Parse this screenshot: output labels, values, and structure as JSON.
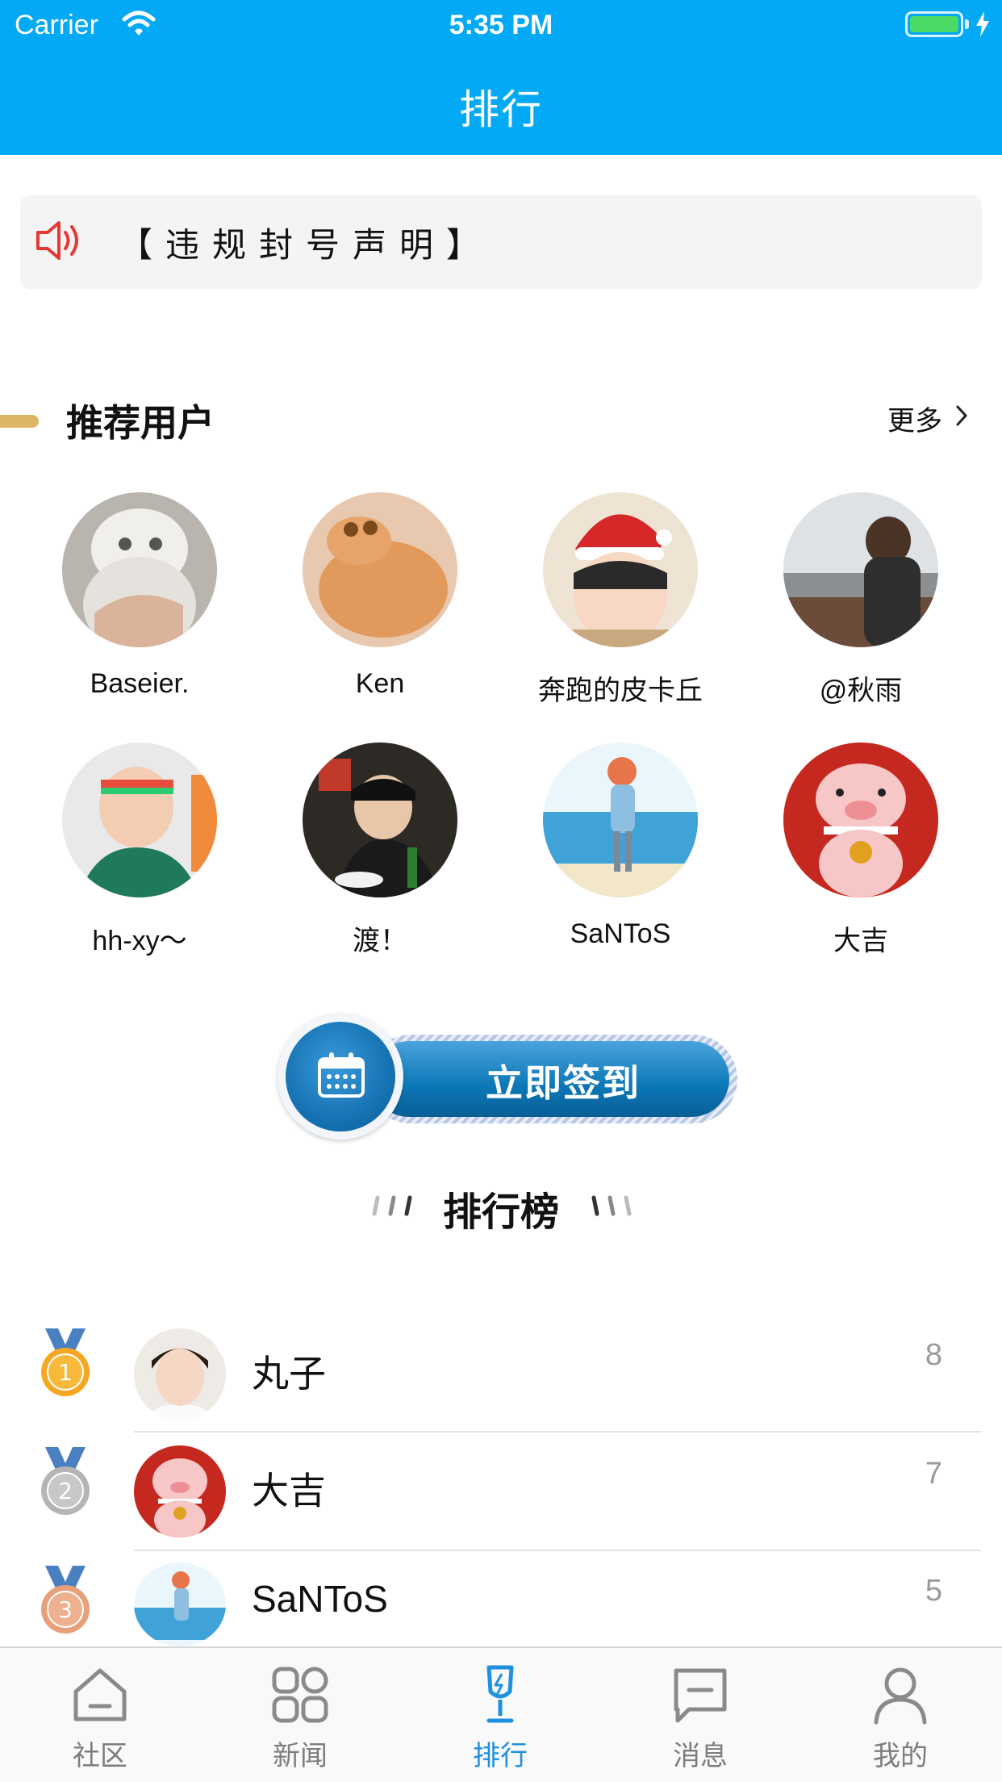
{
  "status_bar": {
    "carrier": "Carrier",
    "time": "5:35 PM"
  },
  "nav": {
    "title": "排行"
  },
  "notice": {
    "text": "【违规封号声明】",
    "icon": "speaker-icon"
  },
  "recommended": {
    "title": "推荐用户",
    "more_label": "更多",
    "users": [
      {
        "name": "Baseier."
      },
      {
        "name": "Ken"
      },
      {
        "name": "奔跑的皮卡丘"
      },
      {
        "name": "@秋雨"
      },
      {
        "name": "hh-xy～"
      },
      {
        "name": "渡！"
      },
      {
        "name": "SaNToS"
      },
      {
        "name": "大吉"
      }
    ]
  },
  "checkin": {
    "label": "立即签到",
    "icon": "calendar-icon"
  },
  "ranking": {
    "title": "排行榜",
    "rows": [
      {
        "rank": "1",
        "name": "丸子",
        "score": "8",
        "medal_color": "#f5a623"
      },
      {
        "rank": "2",
        "name": "大吉",
        "score": "7",
        "medal_color": "#b5b5b5"
      },
      {
        "rank": "3",
        "name": "SaNToS",
        "score": "5",
        "medal_color": "#e8a07a"
      }
    ]
  },
  "tabbar": {
    "active_color": "#1e90e0",
    "tabs": [
      {
        "label": "社区",
        "icon": "home-icon"
      },
      {
        "label": "新闻",
        "icon": "grid-icon"
      },
      {
        "label": "排行",
        "icon": "trophy-icon"
      },
      {
        "label": "消息",
        "icon": "message-icon"
      },
      {
        "label": "我的",
        "icon": "user-icon"
      }
    ]
  }
}
